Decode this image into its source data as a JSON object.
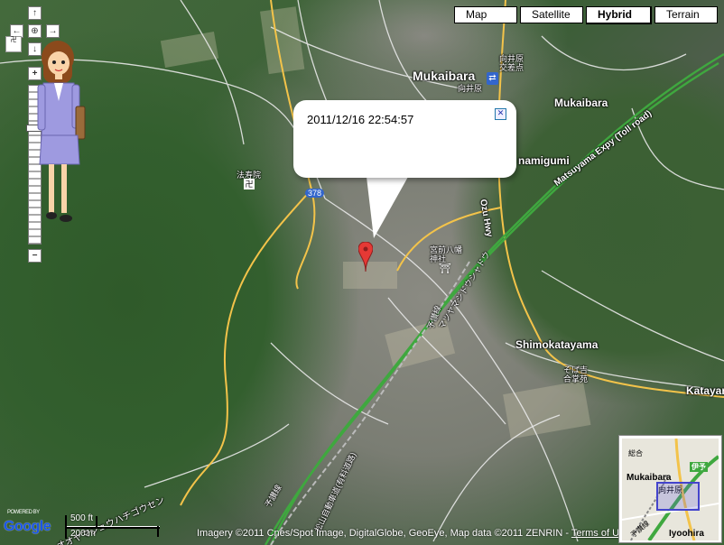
{
  "map_type": {
    "buttons": [
      {
        "label": "Map",
        "selected": false
      },
      {
        "label": "Satellite",
        "selected": false
      },
      {
        "label": "Hybrid",
        "selected": true
      },
      {
        "label": "Terrain",
        "selected": false
      }
    ]
  },
  "nav": {
    "up": "↑",
    "left": "←",
    "center": "⊕",
    "right": "→",
    "down": "↓",
    "zoom_in": "+",
    "zoom_out": "−",
    "zoom_level_fraction": 0.25
  },
  "infowindow": {
    "text": "2011/12/16 22:54:57",
    "close": "✕"
  },
  "places": {
    "mukaibara": "Mukaibara",
    "mukaibara_right": "Mukaibara",
    "namigumi": "namigumi",
    "shimokatayama": "Shimokatayama",
    "katayama": "Katayar",
    "matsuyama_expy": "Matsuyama Expy (Toll road)",
    "ozu_hwy": "Ozu Hwy",
    "route_378": "378",
    "mukaibara_jp": "向井原",
    "mukaibara_koten": "向井原\n交差点",
    "hojuin": "法寿院",
    "shrine": "宮前八幡\n神社",
    "sobakichi": "そば吉\n合掌苑",
    "mukaibara_station": "向井原",
    "yosan_line_1": "予讃線",
    "yosan_line_2": "予讃線",
    "matsuyama_exp_jp": "松山自動車道(有料道路)",
    "kana_road": "マツヤマジドウシャドウ",
    "kana_road2": "オオヤマジュウハチゴウセン"
  },
  "scale": {
    "top": "500 ft",
    "bottom": "200 m"
  },
  "logo": {
    "powered": "POWERED BY",
    "text": "Google"
  },
  "copyright": {
    "text": "Imagery ©2011 Cnes/Spot Image, DigitalGlobe, GeoEye, Map data ©2011 ZENRIN - ",
    "terms": "Terms of Use"
  },
  "overview": {
    "label_mukaibara": "Mukaibara",
    "label_mukaibara_jp": "向井原",
    "label_iyo": "伊予",
    "label_iyoohira": "Iyoohira",
    "label_sogo": "総合",
    "label_yosan": "予讃線"
  },
  "colors": {
    "road_white": "#ffffff",
    "road_yellow": "#f3c34a",
    "expressway": "#3fa83f",
    "marker": "#e53935",
    "overview_box": "#4444cc"
  }
}
